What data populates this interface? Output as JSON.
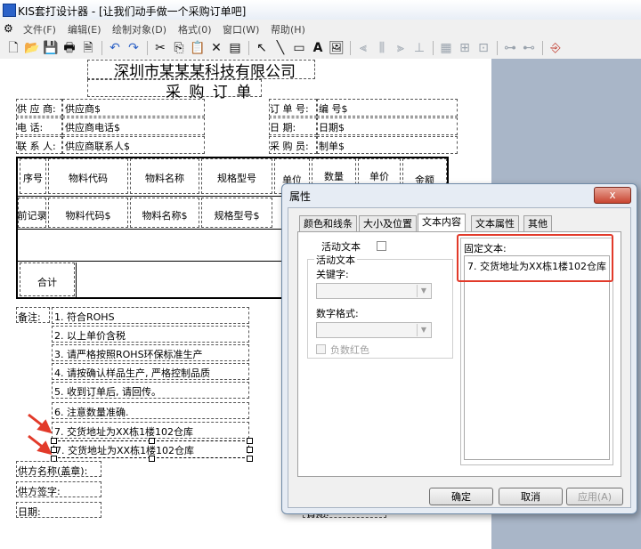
{
  "window": {
    "title": "KIS套打设计器 - [让我们动手做一个采购订单吧]"
  },
  "menu": [
    "文件(F)",
    "编辑(E)",
    "绘制对象(D)",
    "格式(0)",
    "窗口(W)",
    "帮助(H)"
  ],
  "toolbar_icons": [
    "new-icon",
    "open-icon",
    "save-icon",
    "print-icon",
    "preview-icon",
    "undo-icon",
    "redo-icon",
    "cut-icon",
    "copy-icon",
    "paste-icon",
    "delete-icon",
    "properties-icon",
    "pointer-icon",
    "line-icon",
    "rectangle-icon",
    "text-icon",
    "image-icon",
    "align-left-icon",
    "align-center-icon",
    "align-right-icon",
    "align-bottom-icon",
    "grid-icon",
    "size-icon",
    "space-icon",
    "order-icon",
    "exit-icon"
  ],
  "report": {
    "company": "深圳市某某某科技有限公司",
    "doc_title": "采 购 订 单",
    "fields": [
      {
        "label": "供 应 商:",
        "value": "供应商$"
      },
      {
        "label": "电    话:",
        "value": "供应商电话$"
      },
      {
        "label": "联 系 人:",
        "value": "供应商联系人$"
      },
      {
        "label": "订 单 号:",
        "value": "编      号$"
      },
      {
        "label": "日    期:",
        "value": "日期$"
      },
      {
        "label": "采 购 员:",
        "value": "制单$"
      }
    ],
    "table_headers": [
      "序号",
      "物料代码",
      "物料名称",
      "规格型号",
      "单位",
      "数量",
      "单价",
      "金额"
    ],
    "table_row": [
      "前记录",
      "物料代码$",
      "物料名称$",
      "规格型号$"
    ],
    "total_label": "合计",
    "notes_label": "备注:",
    "notes": [
      "1. 符合ROHS",
      "2. 以上单价含税",
      "3. 请严格按照ROHS环保标准生产",
      "4. 请按确认样品生产, 严格控制品质",
      "5. 收到订单后, 请回传。",
      "6. 注意数量准确.",
      "7. 交货地址为XX栋1楼102仓库",
      "7. 交货地址为XX栋1楼102仓库"
    ],
    "supplier_name": "供方名称(盖章):",
    "supplier_sign": "供方签字:",
    "date_label": "日期:",
    "date_label2": "日期:"
  },
  "dialog": {
    "title": "属性",
    "close": "x",
    "tabs": [
      "颜色和线条",
      "大小及位置",
      "文本内容",
      "文本属性",
      "其他"
    ],
    "active_tab": "文本内容",
    "active_text_label": "活动文本",
    "group_label": "活动文本",
    "keyword_label": "关键字:",
    "number_format_label": "数字格式:",
    "negative_red_label": "负数红色",
    "fixed_text_label": "固定文本:",
    "fixed_text_value": "7. 交货地址为XX栋1楼102仓库",
    "ok": "确定",
    "cancel": "取消",
    "apply": "应用(A)"
  },
  "colors": {
    "highlight_red": "#e23a2a",
    "canvas_gray": "#a9b6c8"
  }
}
